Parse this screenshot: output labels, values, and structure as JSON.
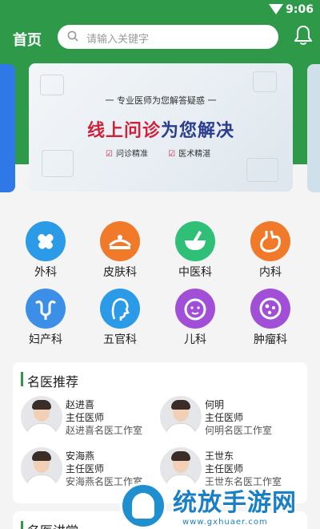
{
  "status": {
    "time": "9:06"
  },
  "header": {
    "title": "首页",
    "search_placeholder": "请输入关键字"
  },
  "banner": {
    "subtitle": "一 专业医师为您解答疑惑 一",
    "headline_red": "线上问诊",
    "headline_blue": "为您解决",
    "tags": [
      "问诊精准",
      "医术精湛"
    ]
  },
  "departments": [
    {
      "label": "外科",
      "color": "#2b9be8",
      "icon": "bandage-icon"
    },
    {
      "label": "皮肤科",
      "color": "#f07a2a",
      "icon": "skin-icon"
    },
    {
      "label": "中医科",
      "color": "#2fbf77",
      "icon": "mortar-icon"
    },
    {
      "label": "内科",
      "color": "#f07a2a",
      "icon": "stomach-icon"
    },
    {
      "label": "妇产科",
      "color": "#3c8fe6",
      "icon": "uterus-icon"
    },
    {
      "label": "五官科",
      "color": "#2b9be8",
      "icon": "face-icon"
    },
    {
      "label": "儿科",
      "color": "#a24fd8",
      "icon": "baby-icon"
    },
    {
      "label": "肿瘤科",
      "color": "#a24fd8",
      "icon": "cell-icon"
    }
  ],
  "recommend": {
    "title": "名医推荐",
    "doctors": [
      {
        "name": "赵进喜",
        "title": "主任医师",
        "studio": "赵进喜名医工作室"
      },
      {
        "name": "何明",
        "title": "主任医师",
        "studio": "何明名医工作室"
      },
      {
        "name": "安海燕",
        "title": "主任医师",
        "studio": "安海燕名医工作室"
      },
      {
        "name": "王世东",
        "title": "主任医师",
        "studio": "王世东名医工作室"
      }
    ]
  },
  "lecture": {
    "title": "名医讲堂"
  },
  "watermark": {
    "text": "统放手游网",
    "url": "www.gxhuaer.com"
  }
}
